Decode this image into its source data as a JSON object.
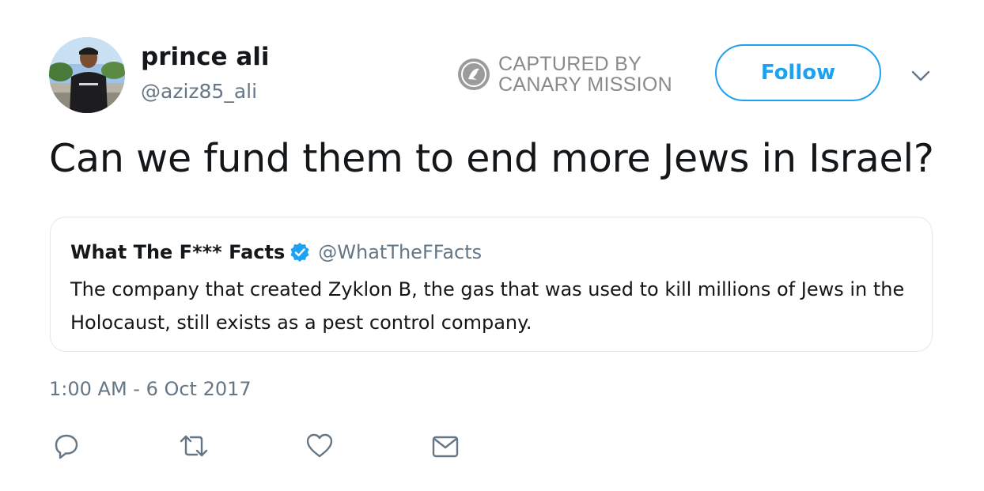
{
  "author": {
    "display_name": "prince ali",
    "handle": "@aziz85_ali",
    "avatar_icon": "profile-photo-avatar"
  },
  "watermark": {
    "line1": "CAPTURED BY",
    "line2": "CANARY MISSION",
    "icon": "canary-bird-icon"
  },
  "follow_label": "Follow",
  "tweet": {
    "text": "Can we fund them to end more Jews in Israel?",
    "timestamp": "1:00 AM - 6 Oct 2017"
  },
  "quote": {
    "name": "What The F*** Facts",
    "handle": "@WhatTheFFacts",
    "verified": true,
    "text": "The company that created Zyklon B, the gas that was used to kill millions of Jews in the Holocaust, still exists as a pest control company."
  },
  "actions": [
    {
      "icon": "reply-icon"
    },
    {
      "icon": "retweet-icon"
    },
    {
      "icon": "like-icon"
    },
    {
      "icon": "direct-message-icon"
    }
  ],
  "colors": {
    "accent": "#1da1f2",
    "text_primary": "#14171a",
    "text_secondary": "#657786",
    "border": "#e1e8ed",
    "watermark": "#8a8a8a"
  }
}
